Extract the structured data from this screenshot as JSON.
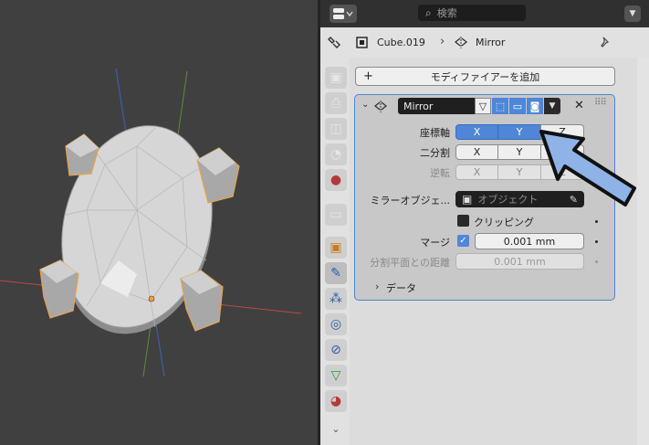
{
  "header": {
    "search_placeholder": "検索",
    "object_name": "Cube.019",
    "breadcrumb_separator": "›",
    "modifier_name": "Mirror"
  },
  "add_modifier": {
    "plus": "+",
    "label": "モディファイアーを追加"
  },
  "modifier": {
    "name": "Mirror",
    "axis_label": "座標軸",
    "bisect_label": "二分割",
    "flip_label": "逆転",
    "axes": [
      "X",
      "Y",
      "Z"
    ],
    "axis_state": [
      true,
      true,
      false
    ],
    "mirror_object_label": "ミラーオブジェ...",
    "mirror_object_placeholder": "オブジェクト",
    "clipping_label": "クリッピング",
    "clipping_checked": false,
    "merge_label": "マージ",
    "merge_checked": true,
    "merge_value": "0.001 mm",
    "bisect_distance_label": "分割平面との距離",
    "bisect_distance_value": "0.001 mm",
    "data_label": "データ"
  },
  "colors": {
    "accent": "#4f86d8",
    "arrow": "#8fb3e6",
    "selection_outline": "#e8a24a"
  },
  "icons": [
    "editor-type-icon",
    "search-icon",
    "menu-chevron-icon",
    "wrench-icon",
    "object-square-icon",
    "mirror-modifier-icon",
    "pin-icon"
  ]
}
